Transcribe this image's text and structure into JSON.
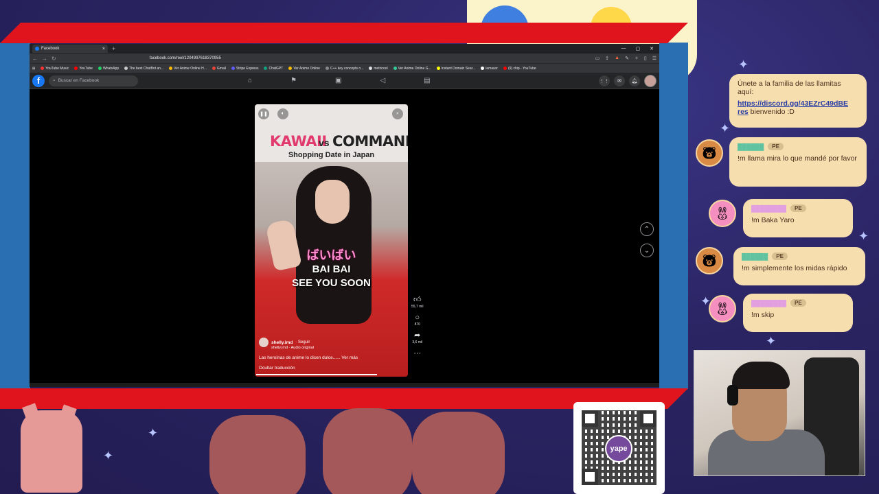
{
  "browser": {
    "tab_title": "Facebook",
    "url": "facebook.com/reel/1204997618370955",
    "bookmarks": [
      "YouTube Music",
      "YouTube",
      "WhatsApp",
      "The best ChatBot an...",
      "Ver Anime Online H...",
      "Gmail",
      "Stripe Express",
      "ChatGPT",
      "Ver Anime Online",
      "C++ key concepts o...",
      "metricool",
      "Ver Anime Online G...",
      "Instant Domain Sear...",
      "lamasor",
      "(9) chip - YouTube"
    ]
  },
  "facebook": {
    "search_placeholder": "Buscar en Facebook"
  },
  "reel": {
    "title_left": "KAWAII",
    "title_vs": "vs",
    "title_right": "COMMAND",
    "subtitle": "Shopping Date in Japan",
    "caption_jp": "ばいばい",
    "caption_1": "BAI BAI",
    "caption_2": "SEE YOU SOON",
    "author": "shelly.imd",
    "follow": "· Seguir",
    "audio": "shelly.imd · Audio original",
    "description": "Las heroínas de anime lo dicen dulce...... Ver más",
    "translate": "Ocultar traducción",
    "likes": "55,7 mil",
    "comments": "870",
    "shares": "3,6 mil"
  },
  "chat": {
    "intro_text": "Únete a la familia de las llamitas aquí:",
    "intro_link": "https://discord.gg/43EZrC49dBE",
    "intro_link_cont": "res",
    "intro_tail": " bienvenido :D",
    "badge": "PE",
    "msg1": "!m llama mira lo que mandé por favor",
    "msg2": "!m Baka Yaro",
    "msg3": "!m simplemente los midas rápido",
    "msg4": "!m skip"
  },
  "qr": {
    "brand": "yape"
  },
  "colors": {
    "frame_red": "#e0141c",
    "frame_blue": "#2b6fb3",
    "chat_bubble": "#f6deae",
    "fb_blue": "#1877f2"
  }
}
